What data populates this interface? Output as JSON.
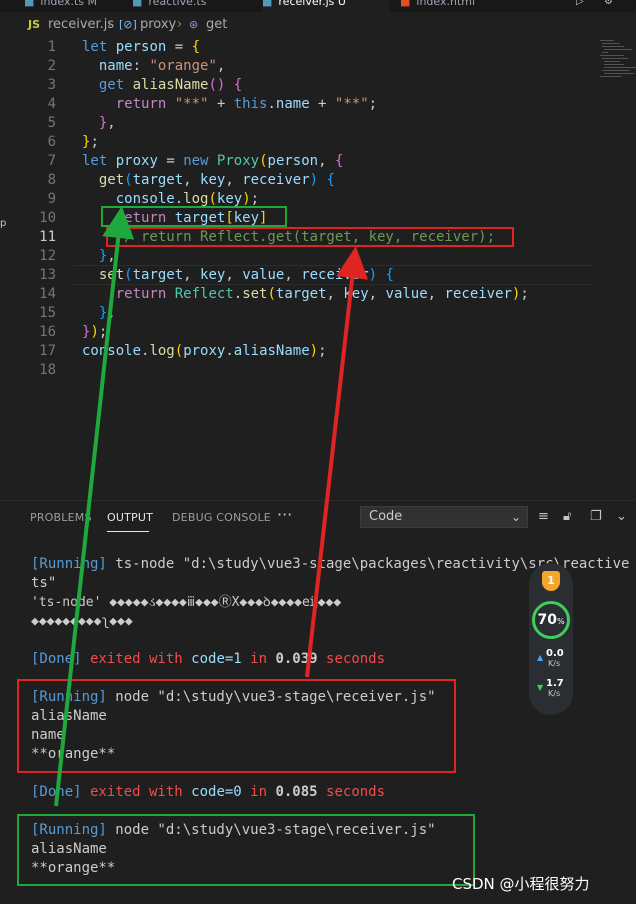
{
  "tabs": [
    {
      "label": "index.ts M",
      "active": false
    },
    {
      "label": "reactive.ts",
      "active": false
    },
    {
      "label": "receiver.js U",
      "active": true
    },
    {
      "label": "index.html",
      "active": false
    }
  ],
  "breadcrumb": {
    "file_badge": "JS",
    "file": "receiver.js",
    "symbol_icon": "[⊘]",
    "symbol": "proxy",
    "method_icon": "⊛",
    "method": "get"
  },
  "editor": {
    "current_line": 11,
    "line_numbers": [
      "1",
      "2",
      "3",
      "4",
      "5",
      "6",
      "7",
      "8",
      "9",
      "10",
      "11",
      "12",
      "13",
      "14",
      "15",
      "16",
      "17",
      "18"
    ]
  },
  "panel": {
    "tabs": [
      "PROBLEMS",
      "OUTPUT",
      "DEBUG CONSOLE"
    ],
    "active_tab": "OUTPUT",
    "more": "···",
    "channel_select": "Code",
    "output": {
      "run1_tag": "[Running]",
      "run1_cmd": " ts-node \"d:\\study\\vue3-stage\\packages\\reactivity\\src\\reactive",
      "run1_cmd_cont": "ts\"",
      "run1_err1": "'ts-node' ◆◆◆◆◆ડ◆◆◆◆ⅲ◆◆◆ⓇX◆◆◆ꝺ◆◆◆◆eĳ◆◆◆",
      "run1_err2": "◆◆◆◆◆◆◆◆◆ʅ◆◆◆",
      "done1_tag": "[Done]",
      "done1_text": " exited with ",
      "done1_code": "code=1",
      "done1_in": " in ",
      "done1_time": "0.039",
      "done1_unit": " seconds",
      "run2_tag": "[Running]",
      "run2_cmd": " node \"d:\\study\\vue3-stage\\receiver.js\"",
      "run2_l1": "aliasName",
      "run2_l2": "name",
      "run2_l3": "**orange**",
      "done2_tag": "[Done]",
      "done2_text": " exited with ",
      "done2_code": "code=0",
      "done2_in": " in ",
      "done2_time": "0.085",
      "done2_unit": " seconds",
      "run3_tag": "[Running]",
      "run3_cmd": " node \"d:\\study\\vue3-stage\\receiver.js\"",
      "run3_l1": "aliasName",
      "run3_l2": "**orange**"
    }
  },
  "widget": {
    "badge": "1",
    "cpu_value": "70",
    "cpu_unit": "%",
    "up_arrow": "▲",
    "up_value": "0.0",
    "up_unit": "K/s",
    "down_arrow": "▼",
    "down_value": "1.7",
    "down_unit": "K/s"
  },
  "watermark": "CSDN @小程很努力",
  "colors": {
    "green_annotation": "#1fa83c",
    "red_annotation": "#e02424",
    "editor_bg": "#1f1f1f"
  }
}
